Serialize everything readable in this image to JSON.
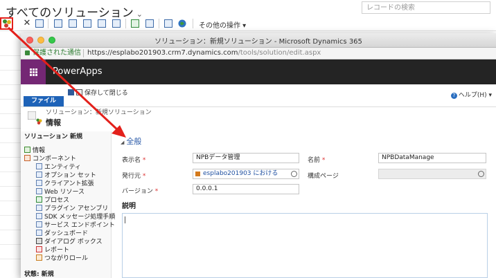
{
  "background": {
    "page_title": "すべてのソリューション",
    "search_placeholder": "レコードの検索",
    "toolbar": {
      "other_actions_label": "その他の操作"
    }
  },
  "window": {
    "title": "ソリューション：新規ソリューション - Microsoft Dynamics 365",
    "address": {
      "secure_label": "保護された通信",
      "url_host": "https://esplabo201903.crm7.dynamics.com",
      "url_path": "/tools/solution/edit.aspx"
    },
    "app_name": "PowerApps"
  },
  "ribbon": {
    "file_tab": "ファイル",
    "save_close_label": "保存して閉じる",
    "help_label": "ヘルプ(H)"
  },
  "header": {
    "breadcrumb": "ソリューション：新規ソリューション",
    "entity_name": "情報"
  },
  "left_nav": {
    "title": "ソリューション 新規",
    "items": [
      {
        "label": "情報",
        "level": 0
      },
      {
        "label": "コンポーネント",
        "level": 0
      },
      {
        "label": "エンティティ",
        "level": 1
      },
      {
        "label": "オプション セット",
        "level": 1
      },
      {
        "label": "クライアント拡張",
        "level": 1
      },
      {
        "label": "Web リソース",
        "level": 1
      },
      {
        "label": "プロセス",
        "level": 1
      },
      {
        "label": "プラグイン アセンブリ",
        "level": 1
      },
      {
        "label": "SDK メッセージ処理手順",
        "level": 1
      },
      {
        "label": "サービス エンドポイント",
        "level": 1
      },
      {
        "label": "ダッシュボード",
        "level": 1
      },
      {
        "label": "ダイアログ ボックス",
        "level": 1
      },
      {
        "label": "レポート",
        "level": 1
      },
      {
        "label": "つながりロール",
        "level": 1
      }
    ],
    "status": "状態: 新規"
  },
  "form": {
    "section_title": "全般",
    "display_name_label": "表示名",
    "display_name_value": "NPBデータ管理",
    "name_label": "名前",
    "name_value": "NPBDataManage",
    "publisher_label": "発行元",
    "publisher_value": "esplabo201903 における",
    "config_page_label": "構成ページ",
    "version_label": "バージョン",
    "version_value": "0.0.0.1",
    "description_label": "説明",
    "required_marker": "*"
  },
  "colors": {
    "accent_red": "#e3201b",
    "powerapps_purple": "#742774",
    "file_tab_blue": "#1e63b8",
    "section_blue": "#2a5aa8"
  }
}
